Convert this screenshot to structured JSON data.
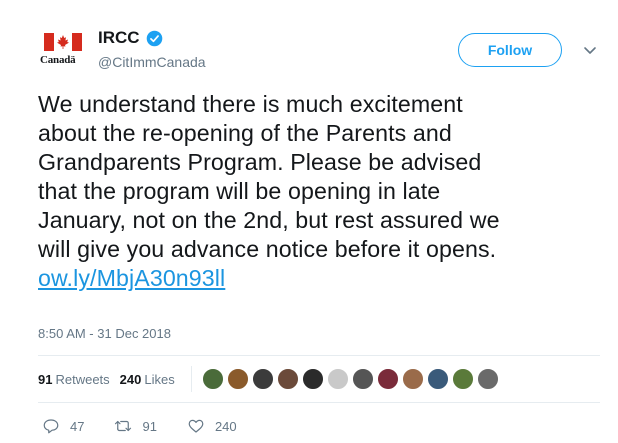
{
  "author": {
    "name": "IRCC",
    "handle": "@CitImmCanada",
    "logo_wordmark": "Canadä"
  },
  "follow_label": "Follow",
  "tweet": {
    "lines": [
      "We understand there is much excitement",
      "about the re-opening of the Parents and",
      "Grandparents Program. Please be advised",
      "that the program will be opening in late",
      "January, not on the 2nd, but rest assured we",
      "will give you advance notice before it opens."
    ],
    "link": "ow.ly/MbjA30n93ll"
  },
  "timestamp": "8:50 AM - 31 Dec 2018",
  "stats": {
    "retweets_count": "91",
    "retweets_label": "Retweets",
    "likes_count": "240",
    "likes_label": "Likes"
  },
  "liker_avatar_colors": [
    "#4a6b3a",
    "#8a5a2b",
    "#3b3b3b",
    "#6b4a3a",
    "#2b2b2b",
    "#c9c9c9",
    "#555555",
    "#7a2b3a",
    "#9a6b4a",
    "#3a5a7a",
    "#5a7a3a",
    "#6a6a6a"
  ],
  "actions": {
    "replies": "47",
    "retweets": "91",
    "likes": "240"
  },
  "colors": {
    "accent": "#1da1f2",
    "link": "#1b95e0",
    "flag_red": "#d52b1e",
    "verified": "#1da1f2",
    "muted": "#657786"
  }
}
